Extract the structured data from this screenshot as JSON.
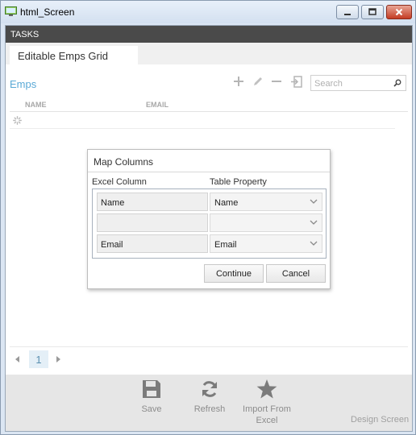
{
  "window": {
    "title": "html_Screen"
  },
  "tasks": {
    "label": "TASKS"
  },
  "tab": {
    "label": "Editable Emps Grid"
  },
  "list": {
    "title": "Emps",
    "search_placeholder": "Search",
    "columns": [
      "NAME",
      "EMAIL"
    ]
  },
  "pager": {
    "current_page": "1"
  },
  "commands": {
    "save": "Save",
    "refresh": "Refresh",
    "import_line1": "Import From",
    "import_line2": "Excel",
    "design_screen": "Design Screen"
  },
  "dialog": {
    "title": "Map Columns",
    "excel_column_header": "Excel Column",
    "table_property_header": "Table Property",
    "rows": [
      {
        "excel": "Name",
        "property": "Name"
      },
      {
        "excel": "",
        "property": ""
      },
      {
        "excel": "Email",
        "property": "Email"
      }
    ],
    "continue_label": "Continue",
    "cancel_label": "Cancel"
  },
  "colors": {
    "accent": "#5aa9d6",
    "tasks_bar": "#4a4a4a",
    "close_button": "#c43b23"
  }
}
